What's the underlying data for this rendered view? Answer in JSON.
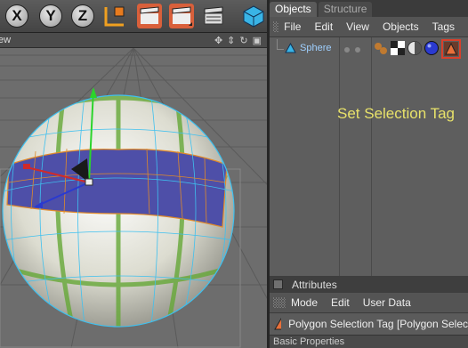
{
  "toolbar": {
    "axes": [
      "X",
      "Y",
      "Z"
    ],
    "icons": [
      "x-axis-lock-icon",
      "y-axis-lock-icon",
      "z-axis-lock-icon",
      "world-coordinate-icon",
      "render-view-icon",
      "render-picture-viewer-icon",
      "render-settings-icon",
      "cube-icon"
    ],
    "colors": {
      "highlight": "#d9603b",
      "cube": "#39b4e6"
    }
  },
  "viewport": {
    "menu_partial": "ew",
    "controls": [
      "move-icon",
      "zoom-icon",
      "rotate-icon",
      "maximize-icon"
    ]
  },
  "object_manager": {
    "tabs": [
      {
        "label": "Objects",
        "active": true
      },
      {
        "label": "Structure",
        "active": false
      }
    ],
    "menu": [
      "File",
      "Edit",
      "View",
      "Objects",
      "Tags"
    ],
    "object": {
      "name": "Sphere",
      "icon": "sphere-object-icon"
    },
    "tags": [
      "phong-tag-icon",
      "texture-tag-icon",
      "material-tag-icon",
      "material-tag-blue-icon",
      "polygon-selection-tag-icon"
    ],
    "callout": "Set Selection Tag",
    "colors": {
      "callout": "#e8e26a",
      "object_name": "#9fd0ff",
      "tag_highlight": "#d9402b"
    }
  },
  "attributes": {
    "title": "Attributes",
    "menu": [
      "Mode",
      "Edit",
      "User Data"
    ],
    "tag_title": "Polygon Selection Tag [Polygon Selec",
    "footer_partial": "Basic Properties"
  }
}
